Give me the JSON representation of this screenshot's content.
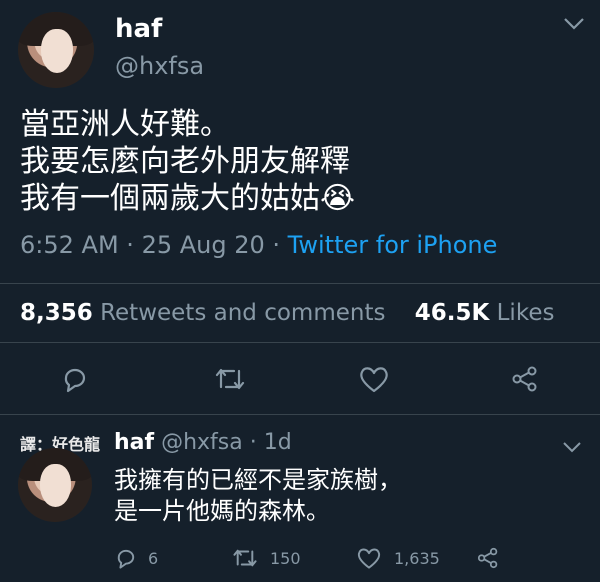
{
  "main_tweet": {
    "author_name": "haf",
    "author_handle": "@hxfsa",
    "text_lines": [
      "當亞洲人好難。",
      "我要怎麼向老外朋友解釋",
      "我有一個兩歲大的姑姑😭"
    ],
    "time": "6:52 AM",
    "date": "25 Aug 20",
    "source": "Twitter for iPhone",
    "retweets_count": "8,356",
    "retweets_label": "Retweets and comments",
    "likes_count": "46.5K",
    "likes_label": "Likes",
    "actions": [
      "reply-icon",
      "retweet-icon",
      "heart-icon",
      "share-icon"
    ]
  },
  "reply_tweet": {
    "translator_note": "譯：好色龍",
    "author_name": "haf",
    "author_handle": "@hxfsa",
    "age": "1d",
    "text_lines": [
      "我擁有的已經不是家族樹，",
      "是一片他媽的森林。"
    ],
    "reply_count": "6",
    "retweet_count": "150",
    "like_count": "1,635"
  },
  "colors": {
    "background": "#15202b",
    "text": "#ffffff",
    "muted": "#8899a6",
    "accent": "#1da1f2",
    "divider": "#38444d"
  }
}
